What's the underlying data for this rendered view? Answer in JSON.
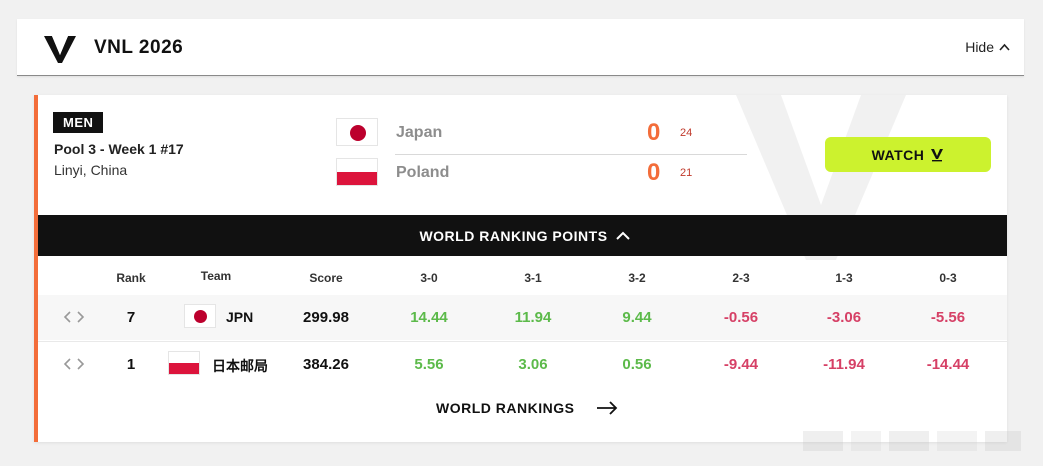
{
  "header": {
    "title": "VNL 2026",
    "hide_label": "Hide",
    "logo_icon": "vnl-logo-icon"
  },
  "match": {
    "gender": "MEN",
    "pool": "Pool 3 - Week 1 #17",
    "venue": "Linyi, China",
    "teams": [
      {
        "name": "Japan",
        "sets": "0",
        "points": "24",
        "flag": "japan-flag"
      },
      {
        "name": "Poland",
        "sets": "0",
        "points": "21",
        "flag": "poland-flag"
      }
    ],
    "watch_label": "WATCH",
    "accent_color": "#f36d3a",
    "watch_color": "#ccf22e"
  },
  "ranking": {
    "bar_label": "WORLD RANKING POINTS",
    "columns": [
      "Rank",
      "Team",
      "Score",
      "3-0",
      "3-1",
      "3-2",
      "2-3",
      "1-3",
      "0-3"
    ],
    "rows": [
      {
        "rank": "7",
        "team": "JPN",
        "score": "299.98",
        "results": [
          "14.44",
          "11.94",
          "9.44",
          "-0.56",
          "-3.06",
          "-5.56"
        ]
      },
      {
        "rank": "1",
        "team": "日本邮局",
        "score": "384.26",
        "results": [
          "5.56",
          "3.06",
          "0.56",
          "-9.44",
          "-11.94",
          "-14.44"
        ]
      }
    ],
    "positive_color": "#5cba4a",
    "negative_color": "#d64066",
    "link_label": "WORLD RANKINGS"
  }
}
